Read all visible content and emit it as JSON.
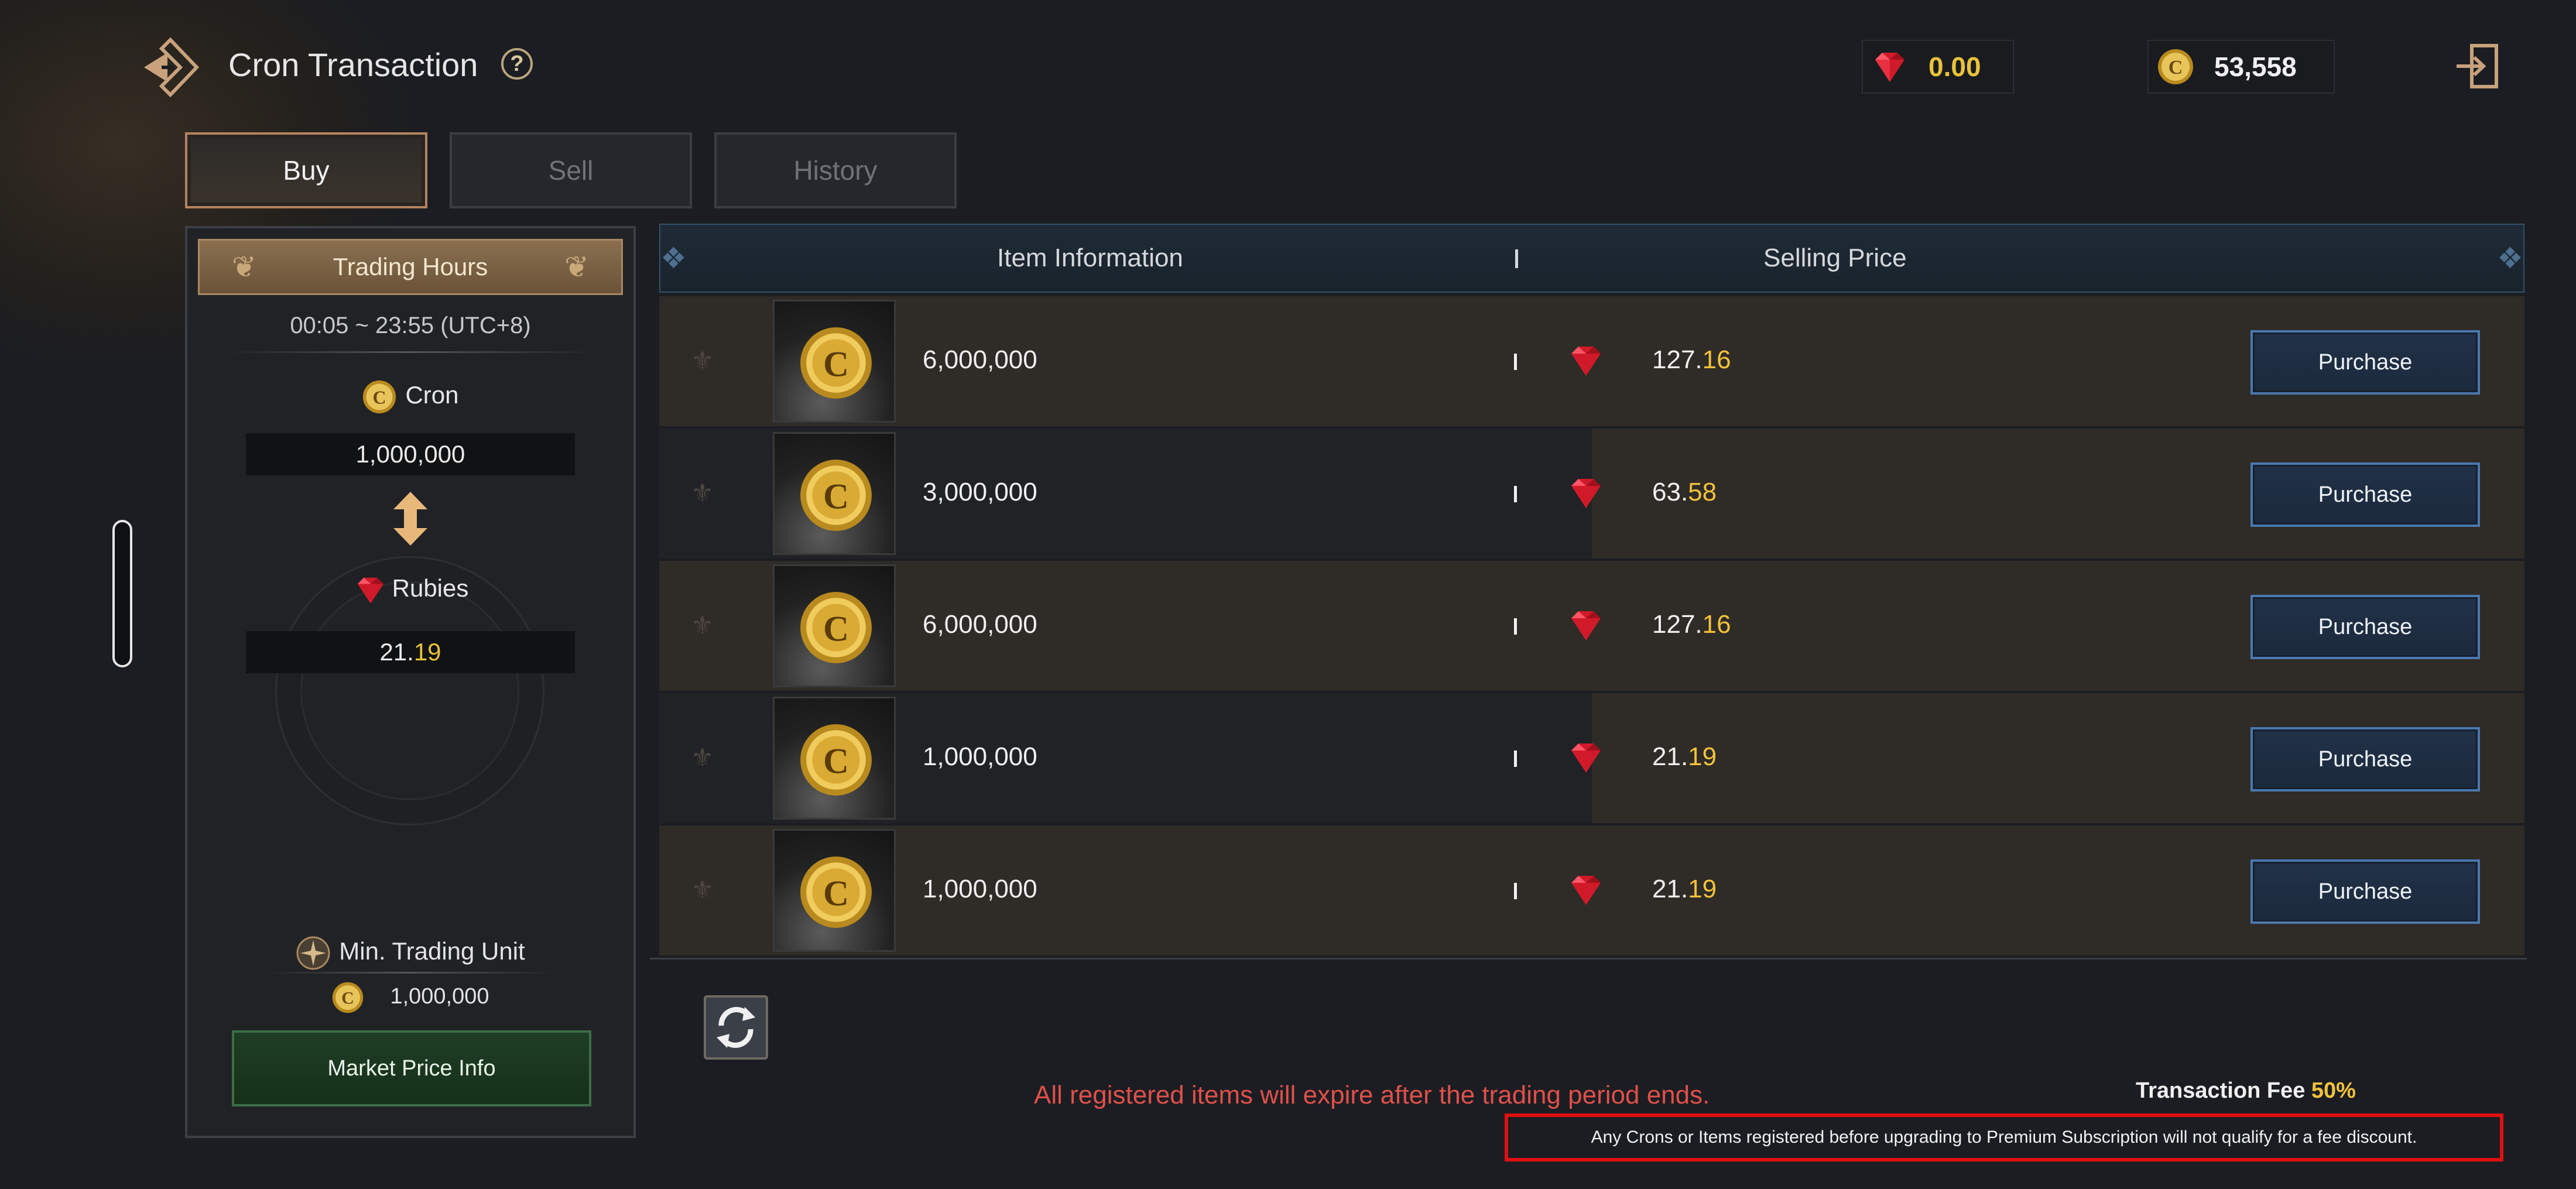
{
  "header": {
    "title": "Cron Transaction",
    "help_icon": "question-mark-icon",
    "rubies_balance": "0.00",
    "cron_balance": "53,558"
  },
  "tabs": [
    {
      "label": "Buy",
      "active": true
    },
    {
      "label": "Sell",
      "active": false
    },
    {
      "label": "History",
      "active": false
    }
  ],
  "left_panel": {
    "trading_hours_title": "Trading Hours",
    "trading_hours_value": "00:05 ~ 23:55 (UTC+8)",
    "cron_label": "Cron",
    "cron_amount": "1,000,000",
    "rubies_label": "Rubies",
    "rubies_int": "21.",
    "rubies_dec": "19",
    "min_unit_label": "Min. Trading Unit",
    "min_unit_value": "1,000,000",
    "market_button": "Market Price Info"
  },
  "table": {
    "col_item": "Item Information",
    "col_price": "Selling Price",
    "rows": [
      {
        "qty": "6,000,000",
        "price_int": "127.",
        "price_dec": "16",
        "button": "Purchase"
      },
      {
        "qty": "3,000,000",
        "price_int": "63.",
        "price_dec": "58",
        "button": "Purchase"
      },
      {
        "qty": "6,000,000",
        "price_int": "127.",
        "price_dec": "16",
        "button": "Purchase"
      },
      {
        "qty": "1,000,000",
        "price_int": "21.",
        "price_dec": "19",
        "button": "Purchase"
      },
      {
        "qty": "1,000,000",
        "price_int": "21.",
        "price_dec": "19",
        "button": "Purchase"
      }
    ]
  },
  "footer": {
    "expire_note": "All registered items will expire after the trading period ends.",
    "fee_label": "Transaction Fee ",
    "fee_value": "50%",
    "discount_note": "Any Crons or Items registered before upgrading to Premium Subscription will not qualify for a fee discount."
  },
  "colors": {
    "accent_gold": "#f2c23a",
    "warning_red": "#e0504a",
    "button_blue": "#4a78b0",
    "market_green": "#3c6d45"
  }
}
